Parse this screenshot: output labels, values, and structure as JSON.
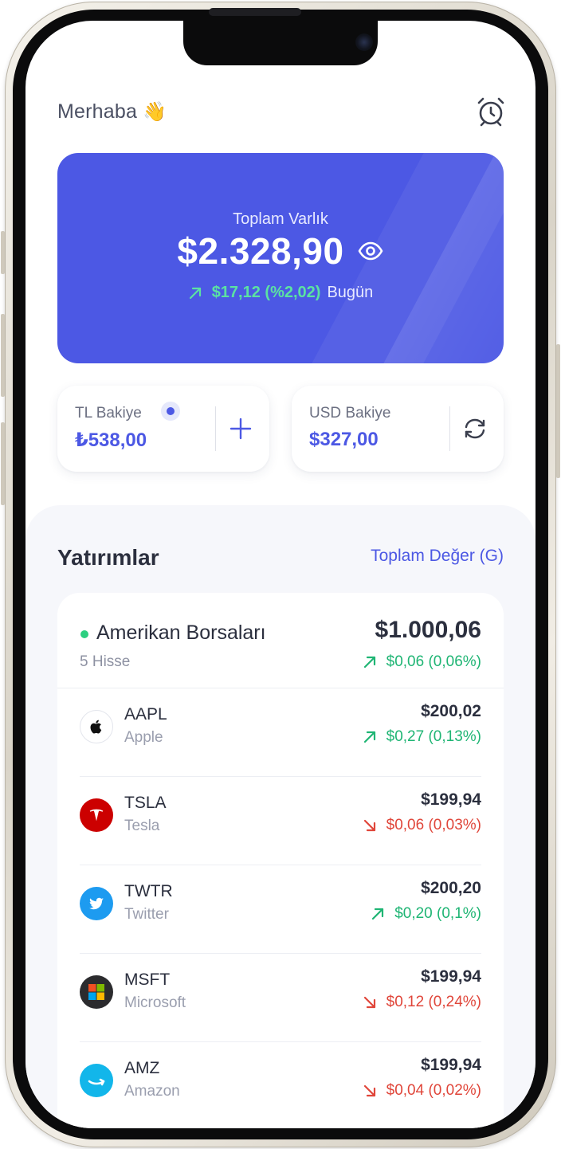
{
  "header": {
    "greeting": "Merhaba",
    "greeting_emoji": "👋",
    "alarm_icon": "alarm-clock-icon"
  },
  "balance": {
    "label": "Toplam Varlık",
    "amount": "$2.328,90",
    "change": "$17,12 (%2,02)",
    "period": "Bugün",
    "trend": "up"
  },
  "tl_wallet": {
    "label": "TL Bakiye",
    "value": "₺538,00",
    "action_icon": "plus-icon"
  },
  "usd_wallet": {
    "label": "USD Bakiye",
    "value": "$327,00",
    "action_icon": "swap-icon"
  },
  "investments": {
    "title": "Yatırımlar",
    "filter_label": "Toplam Değer (G)",
    "group": {
      "name": "Amerikan Borsaları",
      "count": "5 Hisse",
      "total": "$1.000,06",
      "change": "$0,06 (0,06%)",
      "trend": "up"
    },
    "stocks": [
      {
        "symbol": "AAPL",
        "name": "Apple",
        "price": "$200,02",
        "change": "$0,27 (0,13%)",
        "trend": "up",
        "icon": "apple-logo-icon"
      },
      {
        "symbol": "TSLA",
        "name": "Tesla",
        "price": "$199,94",
        "change": "$0,06 (0,03%)",
        "trend": "down",
        "icon": "tesla-logo-icon"
      },
      {
        "symbol": "TWTR",
        "name": "Twitter",
        "price": "$200,20",
        "change": "$0,20 (0,1%)",
        "trend": "up",
        "icon": "twitter-logo-icon"
      },
      {
        "symbol": "MSFT",
        "name": "Microsoft",
        "price": "$199,94",
        "change": "$0,12 (0,24%)",
        "trend": "down",
        "icon": "microsoft-logo-icon"
      },
      {
        "symbol": "AMZ",
        "name": "Amazon",
        "price": "$199,94",
        "change": "$0,04 (0,02%)",
        "trend": "down",
        "icon": "amazon-logo-icon"
      }
    ]
  },
  "colors": {
    "accent": "#4c58e4",
    "positive": "#1fb574",
    "negative": "#e0463a",
    "card_positive": "#5be2a2"
  }
}
